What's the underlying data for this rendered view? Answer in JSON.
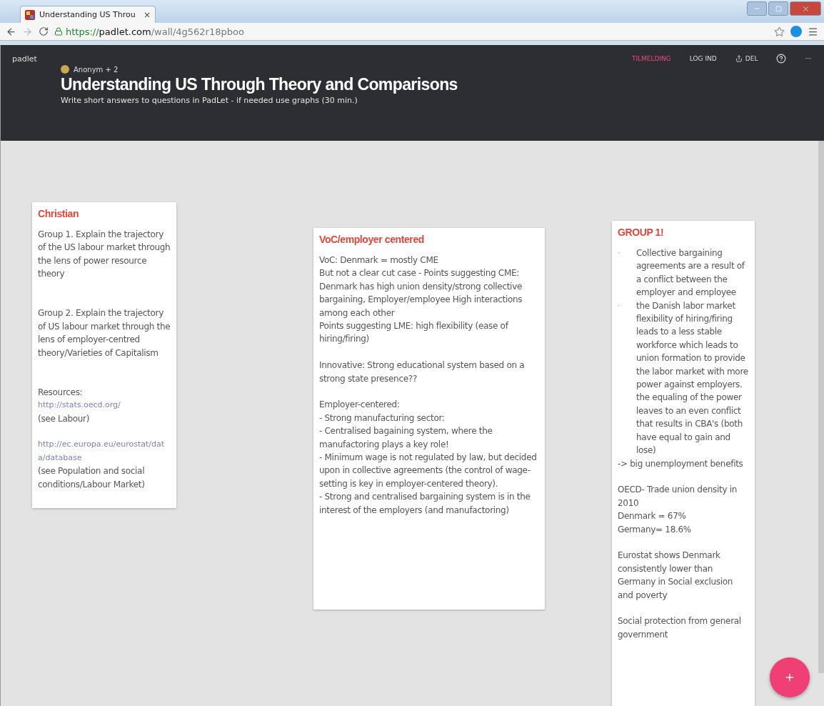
{
  "browser": {
    "tab": {
      "title": "Understanding US Throu",
      "close": "×"
    },
    "address": {
      "scheme": "https://",
      "host": "padlet.com",
      "path": "/wall/4g562r18pboo"
    }
  },
  "header": {
    "logo": "padlet",
    "nav": [
      {
        "label": "TILMELDING",
        "kind": "highlight"
      },
      {
        "label": "LOG IND",
        "kind": "plain"
      },
      {
        "label": "DEL",
        "kind": "share"
      },
      {
        "kind": "help"
      },
      {
        "label": "···",
        "kind": "plain"
      }
    ],
    "authors": "Anonym + 2",
    "title": "Understanding US Through Theory and Comparisons",
    "subtitle": "Write short answers to questions in PadLet - if needed use graphs (30 min.)"
  },
  "posts": [
    {
      "title": "Christian",
      "lines": [
        {
          "kind": "text",
          "text": "Group 1. Explain the trajectory of the US labour market through the lens of power resource theory"
        },
        {
          "kind": "blank"
        },
        {
          "kind": "blank"
        },
        {
          "kind": "text",
          "text": "Group 2. Explain the trajectory of US labour market through the lens of employer-centred theory/Varieties of Capitalism"
        },
        {
          "kind": "blank"
        },
        {
          "kind": "blank"
        },
        {
          "kind": "text",
          "text": "Resources:"
        },
        {
          "kind": "link",
          "text": "http://stats.oecd.org/"
        },
        {
          "kind": "text",
          "text": "(see Labour)"
        },
        {
          "kind": "blank"
        },
        {
          "kind": "link",
          "text": "http://ec.europa.eu/eurostat/data/database"
        },
        {
          "kind": "text",
          "text": "(see Population and social conditions/Labour Market)"
        }
      ]
    },
    {
      "title": "VoC/employer centered",
      "lines": [
        {
          "kind": "text",
          "text": "VoC: Denmark = mostly CME"
        },
        {
          "kind": "text",
          "text": "But not a clear cut case - Points suggesting CME: Denmark has high union density/strong collective bargaining, Employer/employee High interactions among each other"
        },
        {
          "kind": "text",
          "text": "Points suggesting LME:  high flexibility (ease of hiring/firing)"
        },
        {
          "kind": "blank"
        },
        {
          "kind": "text",
          "text": "Innovative: Strong educational system based on a strong state presence??"
        },
        {
          "kind": "blank"
        },
        {
          "kind": "text",
          "text": "Employer-centered:"
        },
        {
          "kind": "text",
          "text": "- Strong manufacturing sector:"
        },
        {
          "kind": "text",
          "text": "- Centralised bagaining system, where the manufactoring plays a key role!"
        },
        {
          "kind": "text",
          "text": "- Minimum wage is not regulated by law, but decided upon in collective agreements (the control of wage-setting is key in employer-centered theory)."
        },
        {
          "kind": "text",
          "text": "- Strong and centralised bargaining system is in the interest of the employers (and manufactoring)"
        }
      ]
    },
    {
      "title": "GROUP 1!",
      "lines": [
        {
          "kind": "bullet",
          "marker": "·",
          "text": "Collective bargaining agreements are a result of a conflict between the employer and employee"
        },
        {
          "kind": "bullet",
          "marker": "·",
          "text": "the Danish labor market flexibility of hiring/firing leads to a less stable workforce which leads to union formation to provide the labor market with more power against employers. the equaling of the power leaves to an even conflict that results in CBA's (both have equal to gain and lose)"
        },
        {
          "kind": "text",
          "text": "-> big unemployment benefits"
        },
        {
          "kind": "blank"
        },
        {
          "kind": "text",
          "text": "OECD- Trade union density in 2010"
        },
        {
          "kind": "text",
          "text": "Denmark = 67%"
        },
        {
          "kind": "text",
          "text": "Germany= 18.6%"
        },
        {
          "kind": "blank"
        },
        {
          "kind": "text",
          "text": "Eurostat shows Denmark consistently lower than Germany in Social exclusion and poverty"
        },
        {
          "kind": "blank"
        },
        {
          "kind": "text",
          "text": "Social protection from general government"
        }
      ]
    }
  ]
}
